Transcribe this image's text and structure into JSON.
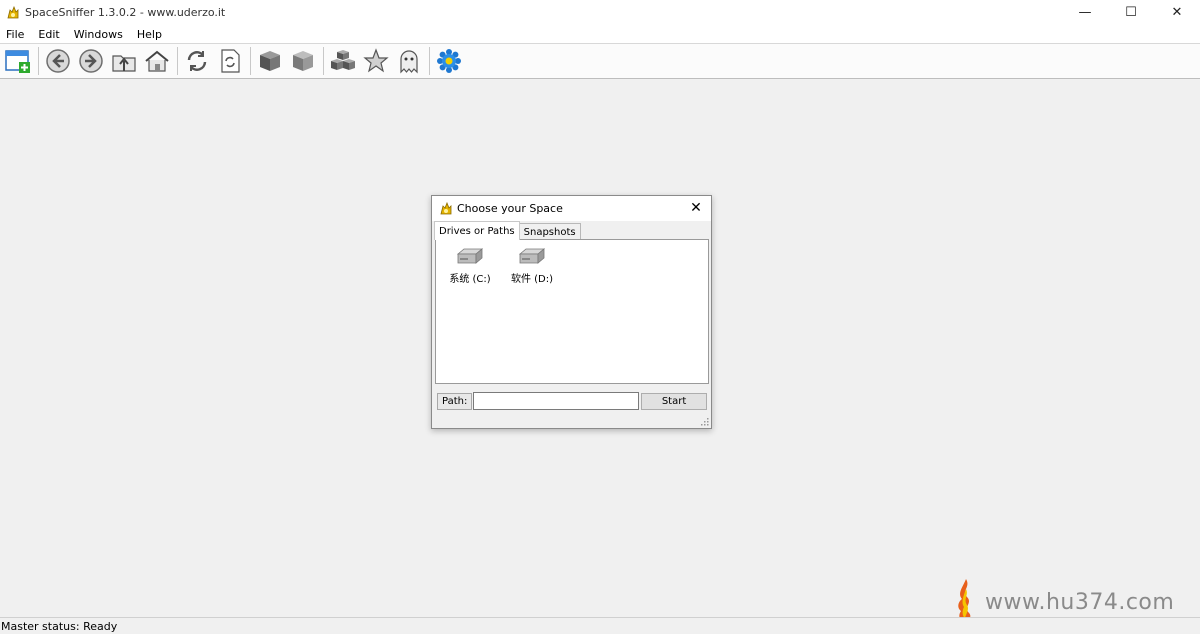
{
  "window": {
    "title": "SpaceSniffer 1.3.0.2 - www.uderzo.it",
    "minimize_glyph": "—",
    "maximize_glyph": "☐",
    "close_glyph": "✕"
  },
  "menu": [
    "File",
    "Edit",
    "Windows",
    "Help"
  ],
  "toolbar": {
    "icons": [
      "new-window-icon",
      "back-icon",
      "forward-icon",
      "up-folder-icon",
      "home-icon",
      "refresh-icon",
      "refresh-document-icon",
      "cube-icon",
      "cube-light-icon",
      "cubes-icon",
      "star-icon",
      "ghost-icon",
      "settings-flower-icon"
    ]
  },
  "dialog": {
    "title": "Choose your Space",
    "close_glyph": "✕",
    "tabs": [
      "Drives or Paths",
      "Snapshots"
    ],
    "drives": [
      "系统 (C:)",
      "软件 (D:)"
    ],
    "path_label": "Path:",
    "path_value": "",
    "start_label": "Start"
  },
  "status": {
    "text": "Master status: Ready"
  },
  "watermark": {
    "text": "www.hu374.com"
  },
  "colors": {
    "background": "#f0f0f0",
    "titlebar": "#ffffff",
    "accent_blue": "#1f78d1"
  }
}
